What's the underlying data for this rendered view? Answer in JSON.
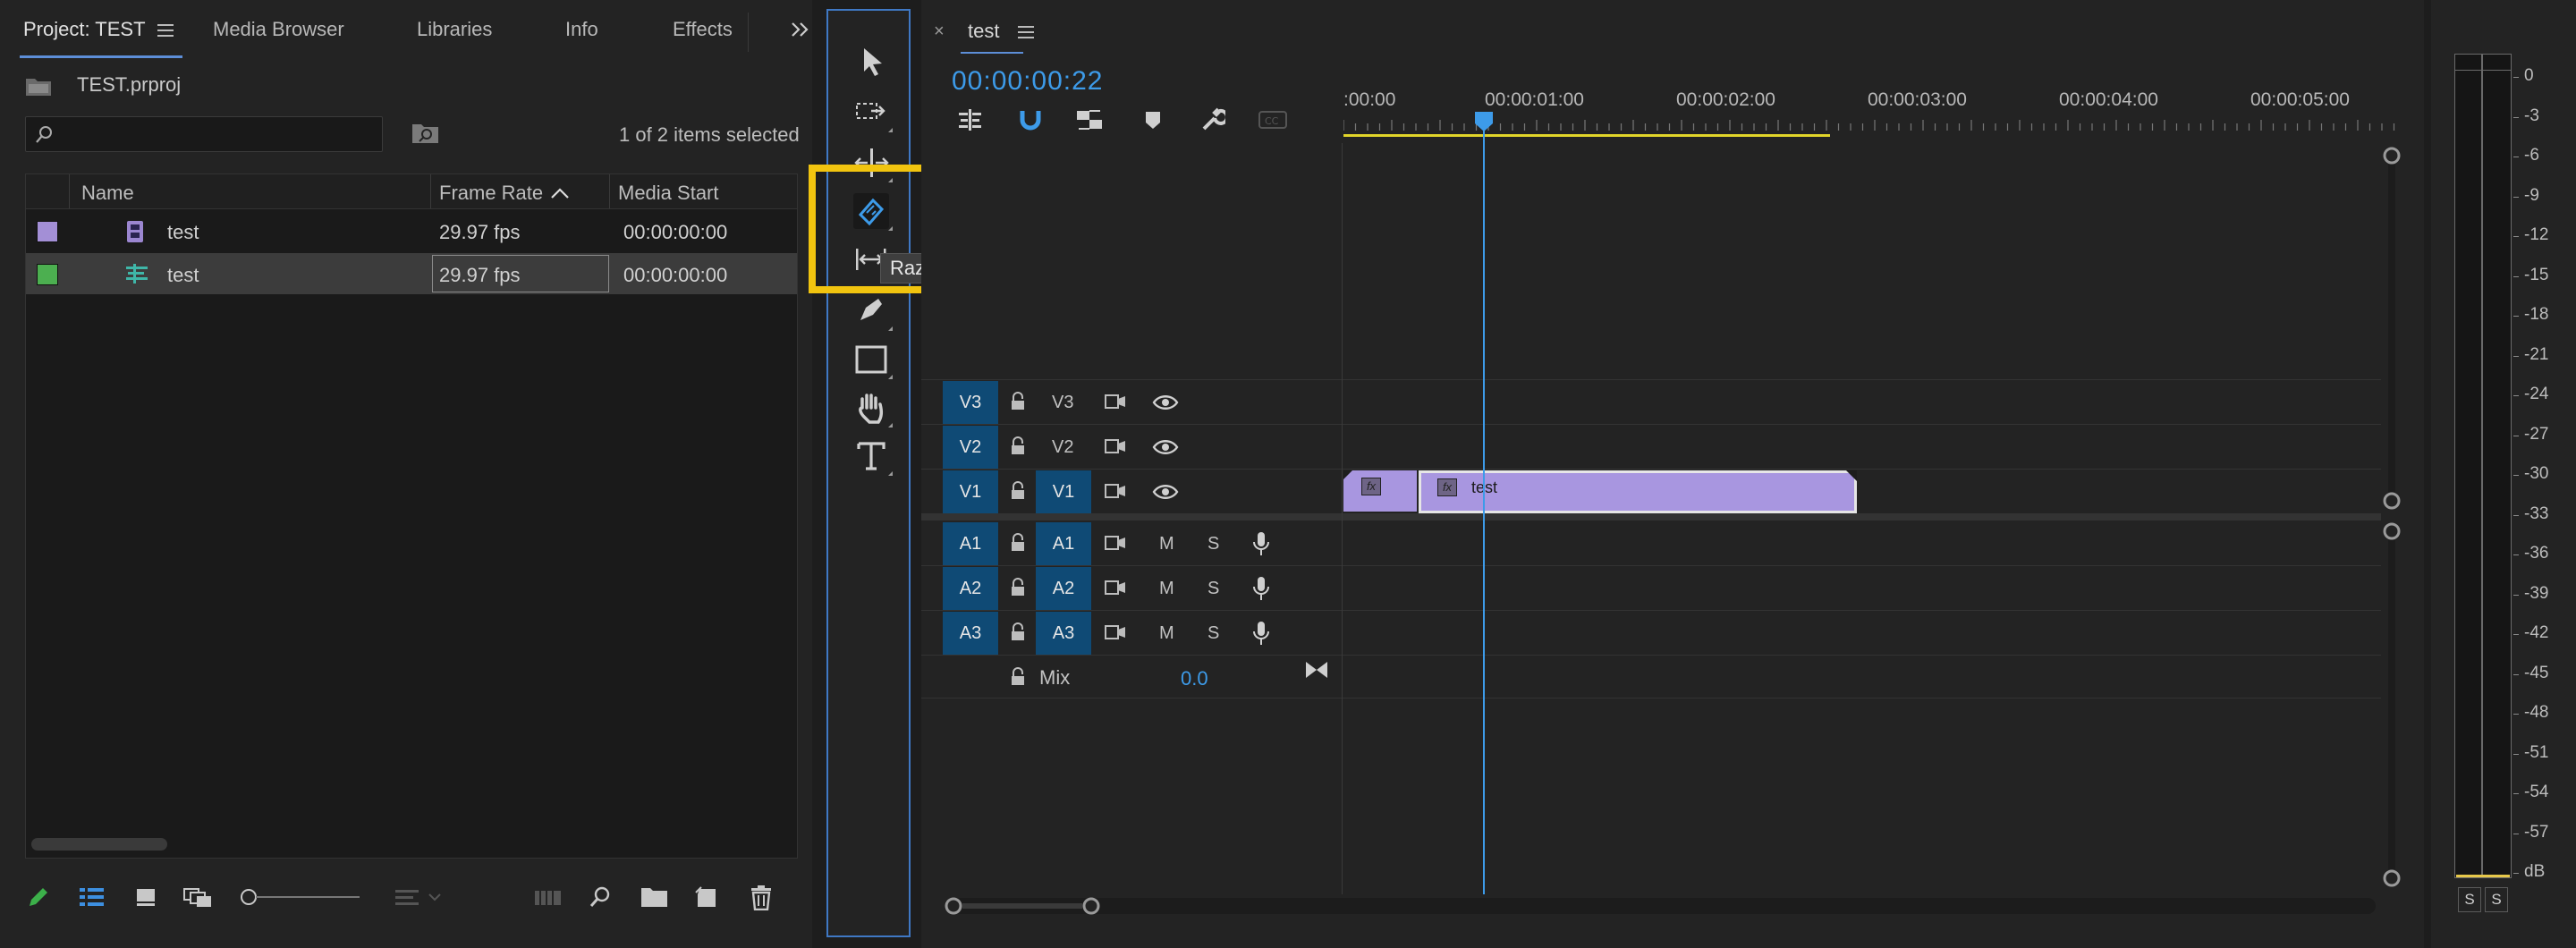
{
  "project_panel": {
    "tabs": [
      {
        "label": "Project: TEST"
      },
      {
        "label": "Media Browser"
      },
      {
        "label": "Libraries"
      },
      {
        "label": "Info"
      },
      {
        "label": "Effects"
      }
    ],
    "project_file": "TEST.prproj",
    "search_placeholder": "",
    "selection_status": "1 of 2 items selected",
    "columns": [
      "Name",
      "Frame Rate",
      "Media Start"
    ],
    "items": [
      {
        "name": "test",
        "frame_rate": "29.97 fps",
        "media_start": "00:00:00:00",
        "swatch": "#a38fd6",
        "icon": "film-icon"
      },
      {
        "name": "test",
        "frame_rate": "29.97 fps",
        "media_start": "00:00:00:00",
        "swatch": "#4caf50",
        "icon": "sequence-icon"
      }
    ]
  },
  "tools_panel": {
    "tools": [
      "selection-tool",
      "track-select-tool",
      "ripple-edit-tool",
      "razor-tool",
      "slip-tool",
      "pen-tool",
      "rectangle-tool",
      "hand-tool",
      "type-tool"
    ],
    "active_tool": "razor-tool",
    "tooltip": "Razor Tool (C)",
    "highlight_color": "#f1c40f"
  },
  "timeline": {
    "sequence_name": "test",
    "timecode": "00:00:00:22",
    "ruler_labels": [
      ":00:00",
      "00:00:01:00",
      "00:00:02:00",
      "00:00:03:00",
      "00:00:04:00",
      "00:00:05:00"
    ],
    "video_tracks": [
      {
        "src": "V3",
        "label": "V3"
      },
      {
        "src": "V2",
        "label": "V2"
      },
      {
        "src": "V1",
        "label": "V1"
      }
    ],
    "audio_tracks": [
      {
        "src": "A1",
        "label": "A1",
        "m": "M",
        "s": "S"
      },
      {
        "src": "A2",
        "label": "A2",
        "m": "M",
        "s": "S"
      },
      {
        "src": "A3",
        "label": "A3",
        "m": "M",
        "s": "S"
      }
    ],
    "mix": {
      "label": "Mix",
      "value": "0.0"
    },
    "clips": [
      {
        "name": "",
        "track": "V1"
      },
      {
        "name": "test",
        "track": "V1"
      }
    ],
    "accent_color": "#3d9be9",
    "clip_color": "#a896e0"
  },
  "audio_meter": {
    "scale": [
      "0",
      "-3",
      "-6",
      "-9",
      "-12",
      "-15",
      "-18",
      "-21",
      "-24",
      "-27",
      "-30",
      "-33",
      "-36",
      "-39",
      "-42",
      "-45",
      "-48",
      "-51",
      "-54",
      "-57",
      "dB"
    ],
    "solo_buttons": [
      "S",
      "S"
    ]
  }
}
